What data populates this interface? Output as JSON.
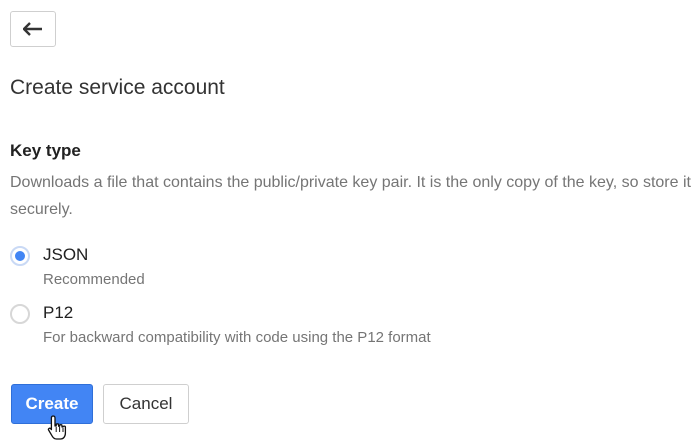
{
  "header": {
    "back_icon": "arrow-back-icon"
  },
  "page": {
    "title": "Create service account"
  },
  "key_type": {
    "heading": "Key type",
    "description": "Downloads a file that contains the public/private key pair. It is the only copy of the key, so store it securely.",
    "options": [
      {
        "label": "JSON",
        "sublabel": "Recommended",
        "selected": true
      },
      {
        "label": "P12",
        "sublabel": "For backward compatibility with code using the P12 format",
        "selected": false
      }
    ]
  },
  "actions": {
    "create_label": "Create",
    "cancel_label": "Cancel"
  },
  "colors": {
    "primary": "#4285f4",
    "muted_text": "#757575"
  }
}
